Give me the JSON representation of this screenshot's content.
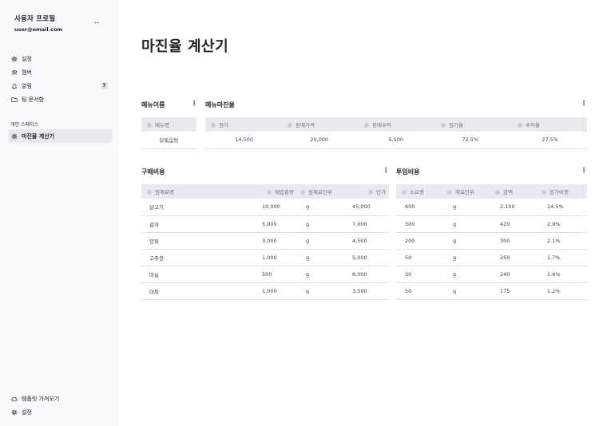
{
  "sidebar": {
    "profile_name": "사용자 프로필",
    "profile_email": "user@email.com",
    "more": "...",
    "nav": [
      {
        "label": "설정",
        "icon": "gear-icon"
      },
      {
        "label": "멤버",
        "icon": "users-icon"
      },
      {
        "label": "알림",
        "icon": "bell-icon",
        "badge": "7"
      },
      {
        "label": "팀 문서함",
        "icon": "folder-icon"
      }
    ],
    "section_label": "개인 스페이스",
    "workspace_items": [
      {
        "label": "마진율 계산기",
        "icon": "gear-icon",
        "active": true
      }
    ],
    "bottom": [
      {
        "label": "템플릿 가져오기",
        "icon": "cloud-icon"
      },
      {
        "label": "설정",
        "icon": "gear-icon"
      }
    ]
  },
  "main": {
    "title": "마진율 계산기",
    "menu_name": {
      "title": "메뉴이름",
      "header": "메뉴명",
      "value": "닭볶음탕"
    },
    "menu_margin": {
      "title": "메뉴마진율",
      "headers": [
        "원가",
        "판매가격",
        "판매수익",
        "원가율",
        "수익율"
      ],
      "row": [
        "14,500",
        "20,000",
        "5,500",
        "72.5%",
        "27.5%"
      ]
    },
    "purchase_cost": {
      "title": "구매비용",
      "headers": [
        "원재료명",
        "매입총량",
        "원재료단위",
        "단가"
      ],
      "rows": [
        [
          "닭고기",
          "10,000",
          "g",
          "45,000"
        ],
        [
          "감자",
          "5,000",
          "g",
          "7,000"
        ],
        [
          "양파",
          "3,000",
          "g",
          "4,500"
        ],
        [
          "고추장",
          "1,000",
          "g",
          "5,000"
        ],
        [
          "마늘",
          "500",
          "g",
          "8,000"
        ],
        [
          "대파",
          "1,000",
          "g",
          "3,500"
        ]
      ]
    },
    "input_cost": {
      "title": "투입비용",
      "headers": [
        "소요량",
        "재료단위",
        "금액",
        "원가비중"
      ],
      "rows": [
        [
          "600",
          "g",
          "2,100",
          "14.5%"
        ],
        [
          "300",
          "g",
          "420",
          "2.9%"
        ],
        [
          "200",
          "g",
          "300",
          "2.1%"
        ],
        [
          "50",
          "g",
          "250",
          "1.7%"
        ],
        [
          "30",
          "g",
          "240",
          "1.6%"
        ],
        [
          "50",
          "g",
          "175",
          "1.2%"
        ]
      ]
    },
    "kebab": "⋮"
  }
}
